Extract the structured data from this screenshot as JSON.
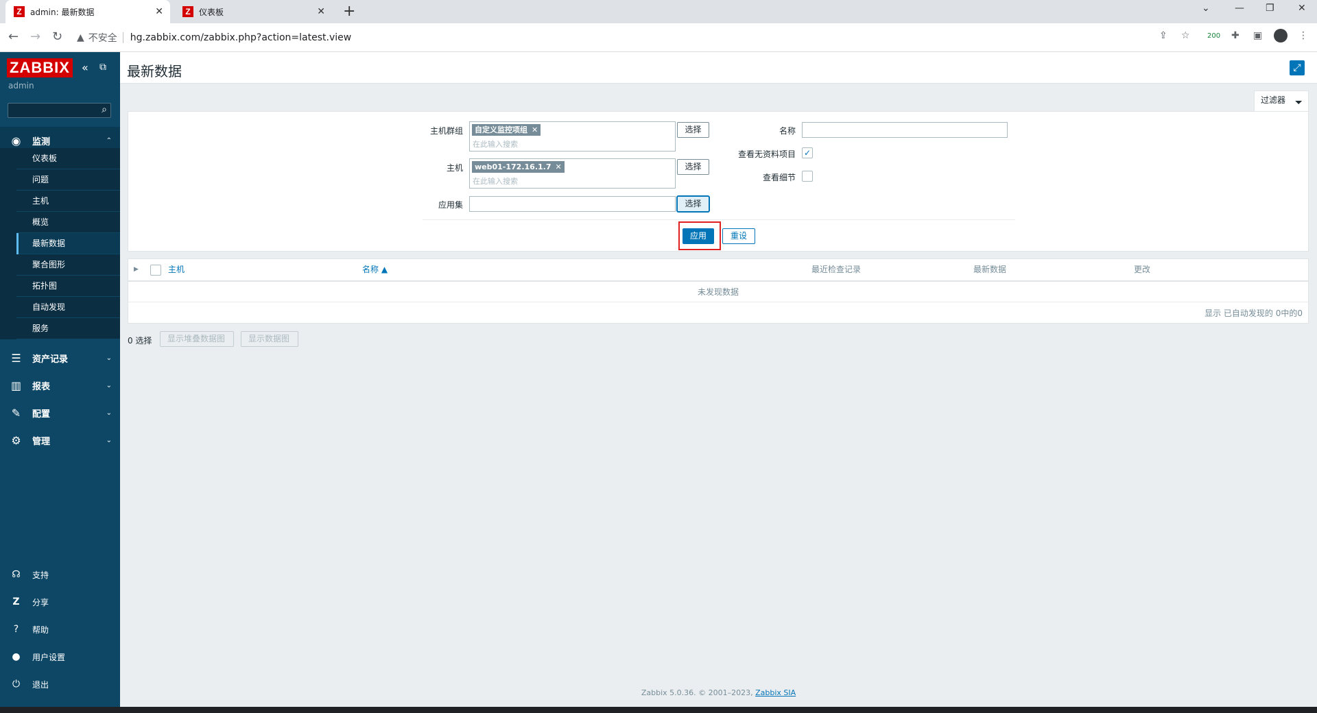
{
  "browser": {
    "tabs": [
      {
        "title": "admin: 最新数据",
        "icon": "zabbix-z-icon"
      },
      {
        "title": "仪表板",
        "icon": "zabbix-z-icon"
      }
    ],
    "security_label": "不安全",
    "url": "hg.zabbix.com/zabbix.php?action=latest.view",
    "extension_badge": "200"
  },
  "sidebar": {
    "logo": "ZABBIX",
    "user": "admin",
    "sections": [
      {
        "label": "监测",
        "icon": "eye-icon",
        "open": true
      },
      {
        "label": "资产记录",
        "icon": "list-icon"
      },
      {
        "label": "报表",
        "icon": "bar-chart-icon"
      },
      {
        "label": "配置",
        "icon": "wrench-icon"
      },
      {
        "label": "管理",
        "icon": "gear-icon"
      }
    ],
    "monitoring_items": [
      "仪表板",
      "问题",
      "主机",
      "概览",
      "最新数据",
      "聚合图形",
      "拓扑图",
      "自动发现",
      "服务"
    ],
    "selected_item": "最新数据",
    "bottom_items": [
      {
        "label": "支持",
        "icon": "headset-icon"
      },
      {
        "label": "分享",
        "icon": "zabbix-share-icon"
      },
      {
        "label": "帮助",
        "icon": "question-icon"
      },
      {
        "label": "用户设置",
        "icon": "user-icon"
      },
      {
        "label": "退出",
        "icon": "power-icon"
      }
    ]
  },
  "page": {
    "title": "最新数据",
    "filter_tab": "过滤器"
  },
  "filter": {
    "host_group_label": "主机群组",
    "host_group_chip": "自定义监控项组",
    "host_label": "主机",
    "host_chip": "web01-172.16.1.7",
    "search_placeholder": "在此输入搜索",
    "application_label": "应用集",
    "select_button": "选择",
    "name_label": "名称",
    "name_value": "",
    "show_without_data_label": "查看无资料项目",
    "show_without_data": true,
    "show_details_label": "查看细节",
    "show_details": false,
    "apply_button": "应用",
    "reset_button": "重设"
  },
  "table": {
    "columns": [
      "主机",
      "名称 ▲",
      "最近检查记录",
      "最新数据",
      "更改"
    ],
    "empty_message": "未发现数据",
    "footer": "显示 已自动发现的 0中的0"
  },
  "actions": {
    "selected_count": "0 选择",
    "stacked_graph_button": "显示堆叠数据图",
    "graph_button": "显示数据图"
  },
  "footer": {
    "text": "Zabbix 5.0.36. © 2001–2023, ",
    "link": "Zabbix SIA"
  },
  "colors": {
    "sidebar": "#0e4766",
    "primary": "#0275b8",
    "logo": "#d40000",
    "highlight": "#e02020"
  }
}
